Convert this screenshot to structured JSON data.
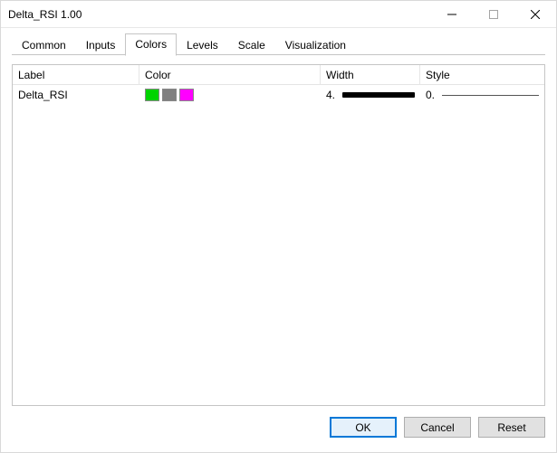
{
  "window": {
    "title": "Delta_RSI 1.00"
  },
  "tabs": [
    {
      "label": "Common",
      "active": false
    },
    {
      "label": "Inputs",
      "active": false
    },
    {
      "label": "Colors",
      "active": true
    },
    {
      "label": "Levels",
      "active": false
    },
    {
      "label": "Scale",
      "active": false
    },
    {
      "label": "Visualization",
      "active": false
    }
  ],
  "columns": {
    "label": "Label",
    "color": "Color",
    "width": "Width",
    "style": "Style"
  },
  "rows": [
    {
      "label": "Delta_RSI",
      "colors": [
        "#00d400",
        "#808080",
        "#ff00ff"
      ],
      "width_text": "4.",
      "style_text": "0."
    }
  ],
  "buttons": {
    "ok": "OK",
    "cancel": "Cancel",
    "reset": "Reset"
  }
}
